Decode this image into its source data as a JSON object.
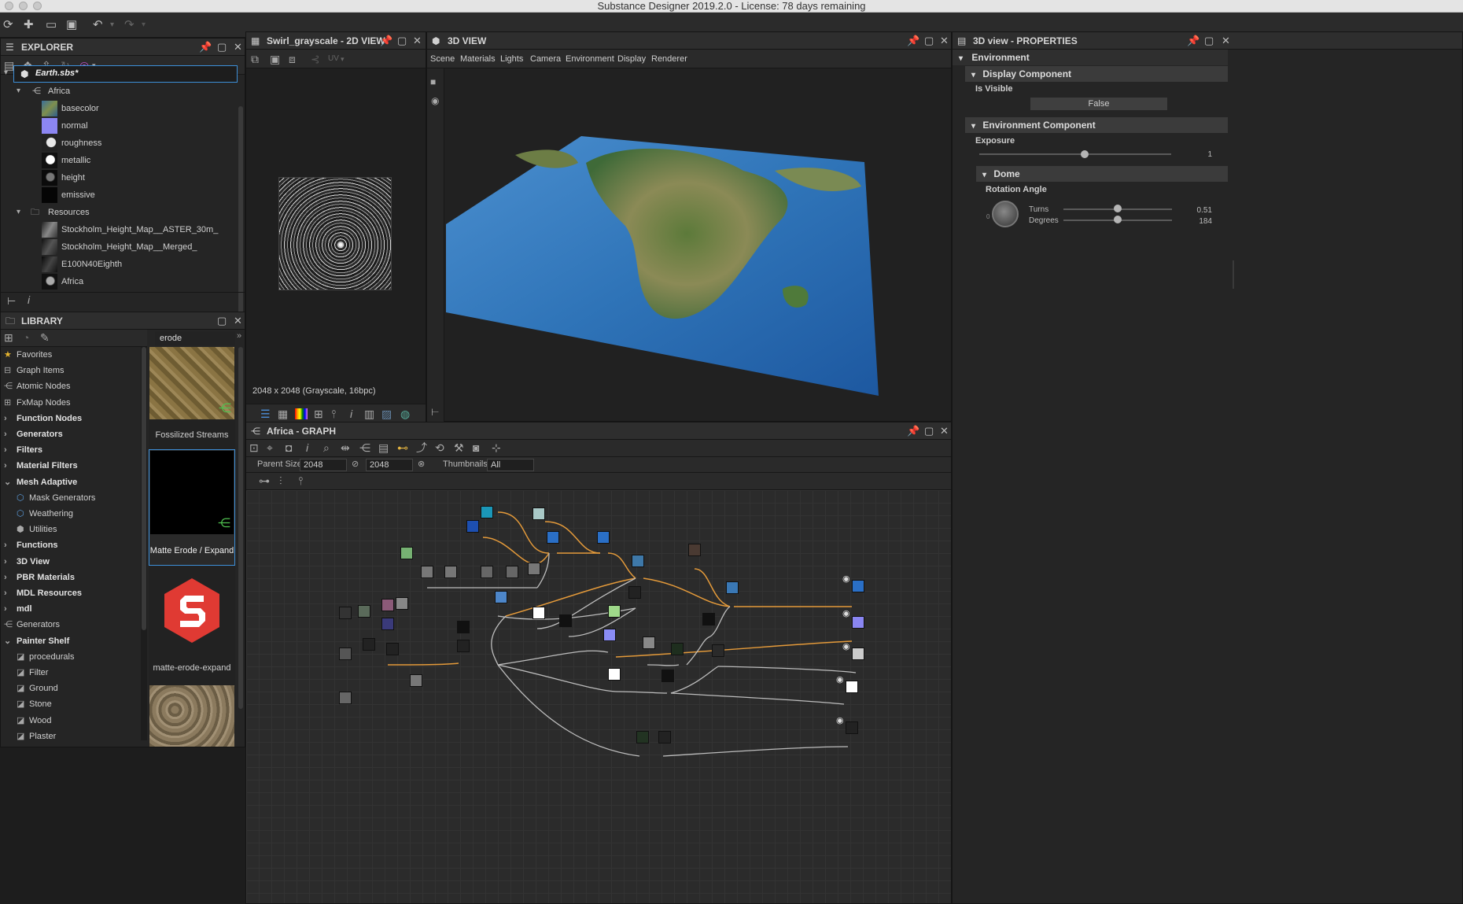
{
  "window": {
    "title": "Substance Designer 2019.2.0 - License: 78 days remaining"
  },
  "explorer": {
    "title": "EXPLORER",
    "file": "Earth.sbs*",
    "graph": "Africa",
    "outputs": [
      "basecolor",
      "normal",
      "roughness",
      "metallic",
      "height",
      "emissive"
    ],
    "resources_folder": "Resources",
    "resources": [
      "Stockholm_Height_Map__ASTER_30m_",
      "Stockholm_Height_Map__Merged_",
      "E100N40Eighth",
      "Africa"
    ]
  },
  "view2d": {
    "title": "Swirl_grayscale - 2D VIEW",
    "uv_label": "UV",
    "info": "2048 x 2048 (Grayscale, 16bpc)"
  },
  "view3d": {
    "title": "3D VIEW",
    "menu": [
      "Scene",
      "Materials",
      "Lights",
      "Camera",
      "Environment",
      "Display",
      "Renderer"
    ]
  },
  "properties": {
    "title": "3D view - PROPERTIES",
    "environment": "Environment",
    "display_component": "Display Component",
    "is_visible_label": "Is Visible",
    "is_visible_value": "False",
    "environment_component": "Environment Component",
    "exposure_label": "Exposure",
    "exposure_value": "1",
    "exposure_fraction": 0.55,
    "dome": "Dome",
    "rotation_label": "Rotation Angle",
    "turns_label": "Turns",
    "turns_value": "0.51",
    "degrees_label": "Degrees",
    "degrees_value": "184",
    "dial_zero": "0"
  },
  "library": {
    "title": "LIBRARY",
    "search": "erode",
    "items": [
      {
        "label": "Favorites",
        "icon": "star-icon",
        "bold": false
      },
      {
        "label": "Graph Items",
        "icon": "graph-items-icon",
        "bold": false
      },
      {
        "label": "Atomic Nodes",
        "icon": "atomic-nodes-icon",
        "bold": false
      },
      {
        "label": "FxMap Nodes",
        "icon": "fxmap-icon",
        "bold": false
      },
      {
        "label": "Function Nodes",
        "icon": "chevron-right-icon",
        "bold": true
      },
      {
        "label": "Generators",
        "icon": "chevron-right-icon",
        "bold": true
      },
      {
        "label": "Filters",
        "icon": "chevron-right-icon",
        "bold": true
      },
      {
        "label": "Material Filters",
        "icon": "chevron-right-icon",
        "bold": true
      },
      {
        "label": "Mesh Adaptive",
        "icon": "chevron-down-icon",
        "bold": true
      },
      {
        "label": "Mask Generators",
        "icon": "mask-icon",
        "bold": false
      },
      {
        "label": "Weathering",
        "icon": "weathering-icon",
        "bold": false
      },
      {
        "label": "Utilities",
        "icon": "utilities-icon",
        "bold": false
      },
      {
        "label": "Functions",
        "icon": "chevron-right-icon",
        "bold": true
      },
      {
        "label": "3D View",
        "icon": "chevron-right-icon",
        "bold": true
      },
      {
        "label": "PBR Materials",
        "icon": "chevron-right-icon",
        "bold": true
      },
      {
        "label": "MDL Resources",
        "icon": "chevron-right-icon",
        "bold": true
      },
      {
        "label": "mdl",
        "icon": "chevron-right-icon",
        "bold": true
      },
      {
        "label": "Generators",
        "icon": "generators-icon",
        "bold": false
      },
      {
        "label": "Painter Shelf",
        "icon": "chevron-down-icon",
        "bold": true
      },
      {
        "label": "procedurals",
        "icon": "shelf-icon",
        "bold": false
      },
      {
        "label": "Filter",
        "icon": "shelf-icon",
        "bold": false
      },
      {
        "label": "Ground",
        "icon": "shelf-icon",
        "bold": false
      },
      {
        "label": "Stone",
        "icon": "shelf-icon",
        "bold": false
      },
      {
        "label": "Wood",
        "icon": "shelf-icon",
        "bold": false
      },
      {
        "label": "Plaster",
        "icon": "shelf-icon",
        "bold": false
      }
    ],
    "results": [
      "Fossilized Streams",
      "Matte Erode / Expand",
      "matte-erode-expand"
    ]
  },
  "graph": {
    "title": "Africa - GRAPH",
    "parent_size_label": "Parent Size:",
    "size_a": "2048",
    "size_b": "2048",
    "thumbnails_label": "Thumbnails:",
    "thumbnails_value": "All"
  },
  "colors": {
    "accent": "#3d8fd8",
    "link_orange": "#e49a3a",
    "substance_red": "#e03a33",
    "node_green": "#3aa54a"
  }
}
